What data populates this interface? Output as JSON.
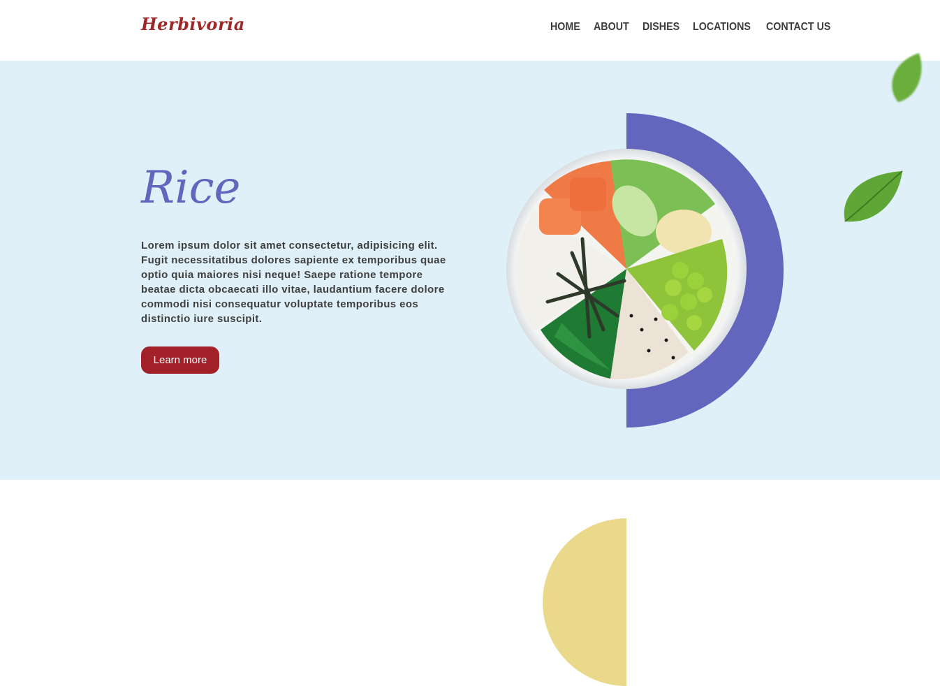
{
  "brand": {
    "logo_text": "Herbivoria"
  },
  "nav": {
    "items": [
      {
        "label": "HOME"
      },
      {
        "label": "ABOUT"
      },
      {
        "label": "DISHES"
      },
      {
        "label": "LOCATIONS"
      },
      {
        "label": "CONTACT US"
      }
    ]
  },
  "hero": {
    "title": "Rice",
    "description": "Lorem ipsum dolor sit amet consectetur, adipisicing elit. Fugit necessitatibus dolores sapiente ex temporibus quae optio quia maiores nisi neque! Saepe ratione tempore beatae dicta obcaecati illo vitae, laudantium facere dolore commodi nisi consequatur voluptate temporibus eos distinctio iure suscipit.",
    "cta_label": "Learn more",
    "image": "rice-poke-bowl-image",
    "decorations": [
      "green-leaf-icon",
      "green-leaf-icon"
    ]
  },
  "colors": {
    "accent": "#6466bd",
    "brand": "#9e2727",
    "button": "#a22027",
    "hero_bg": "#dff0f8",
    "next_section_accent": "#ead98a"
  }
}
